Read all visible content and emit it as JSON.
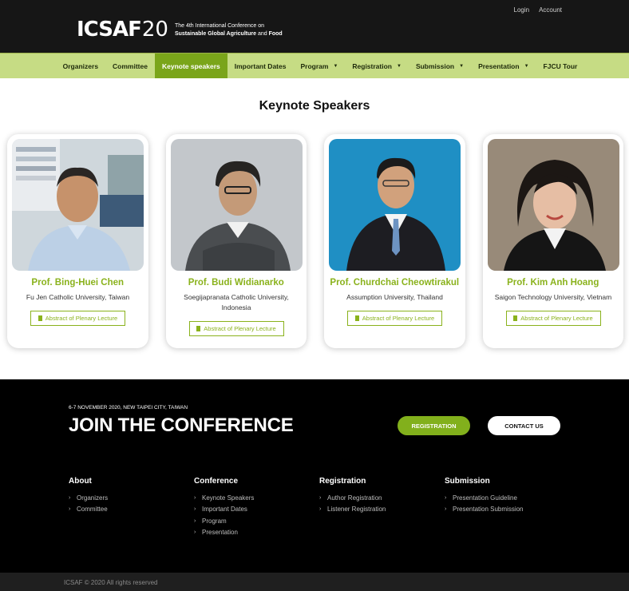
{
  "header": {
    "logo": {
      "name": "ICSAF",
      "year": "20",
      "tagline_1": "The 4th International Conference on",
      "tagline_2a": "Sustainable Global Agriculture",
      "tagline_2b": "and",
      "tagline_2c": "Food"
    },
    "top_links": {
      "login": "Login",
      "account": "Account"
    }
  },
  "nav": {
    "items": [
      {
        "label": "Organizers"
      },
      {
        "label": "Committee"
      },
      {
        "label": "Keynote speakers"
      },
      {
        "label": "Important Dates"
      },
      {
        "label": "Program"
      },
      {
        "label": "Registration"
      },
      {
        "label": "Submission"
      },
      {
        "label": "Presentation"
      },
      {
        "label": "FJCU Tour"
      }
    ],
    "active_index": 2,
    "dropdown_icon": "chevron-down-icon"
  },
  "main": {
    "title": "Keynote Speakers",
    "speakers": [
      {
        "name": "Prof. Bing-Huei Chen",
        "affiliation": "Fu Jen Catholic University, Taiwan",
        "button": "Abstract of Plenary Lecture"
      },
      {
        "name": "Prof. Budi Widianarko",
        "affiliation": "Soegijapranata Catholic University, Indonesia",
        "button": "Abstract of Plenary Lecture"
      },
      {
        "name": "Prof. Churdchai Cheowtirakul",
        "affiliation": "Assumption University, Thailand",
        "button": "Abstract of Plenary Lecture"
      },
      {
        "name": "Prof. Kim Anh Hoang",
        "affiliation": "Saigon Technology University, Vietnam",
        "button": "Abstract of Plenary Lecture"
      }
    ]
  },
  "footer": {
    "date_line": "6-7 NOVEMBER 2020, NEW TAIPEI CITY, TAIWAN",
    "headline": "JOIN THE CONFERENCE",
    "registration_button": "REGISTRATION",
    "contact_button": "CONTACT US",
    "columns": [
      {
        "title": "About",
        "links": [
          "Organizers",
          "Committee"
        ]
      },
      {
        "title": "Conference",
        "links": [
          "Keynote Speakers",
          "Important Dates",
          "Program",
          "Presentation"
        ]
      },
      {
        "title": "Registration",
        "links": [
          "Author Registration",
          "Listener Registration"
        ]
      },
      {
        "title": "Submission",
        "links": [
          "Presentation Guideline",
          "Presentation Submission"
        ]
      }
    ],
    "copyright": "ICSAF © 2020 All rights reserved"
  },
  "colors": {
    "accent_green": "#8ab21c",
    "nav_bg": "#c6dc84",
    "header_bg": "#161616",
    "footer_bg": "#000000"
  }
}
